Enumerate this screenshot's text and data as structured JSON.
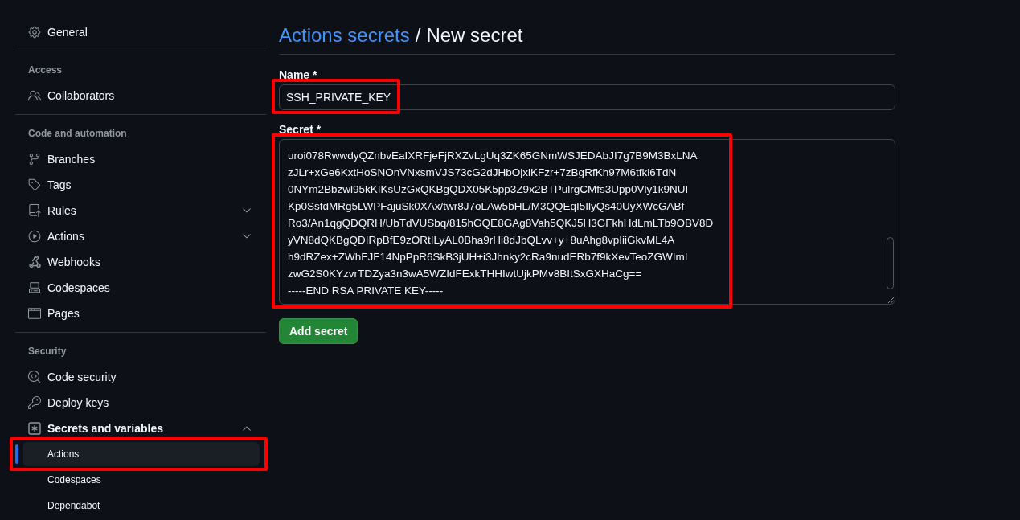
{
  "sidebar": {
    "sections": [
      {
        "items": [
          {
            "label": "General"
          }
        ]
      },
      {
        "heading": "Access",
        "items": [
          {
            "label": "Collaborators"
          }
        ]
      },
      {
        "heading": "Code and automation",
        "items": [
          {
            "label": "Branches"
          },
          {
            "label": "Tags"
          },
          {
            "label": "Rules",
            "expanded": false
          },
          {
            "label": "Actions",
            "expanded": false
          },
          {
            "label": "Webhooks"
          },
          {
            "label": "Codespaces"
          },
          {
            "label": "Pages"
          }
        ]
      },
      {
        "heading": "Security",
        "items": [
          {
            "label": "Code security"
          },
          {
            "label": "Deploy keys"
          },
          {
            "label": "Secrets and variables",
            "expanded": true,
            "children": [
              {
                "label": "Actions",
                "selected": true,
                "highlighted": true
              },
              {
                "label": "Codespaces",
                "selected": false,
                "highlighted": false
              },
              {
                "label": "Dependabot",
                "selected": false,
                "highlighted": false
              }
            ]
          }
        ]
      }
    ]
  },
  "header": {
    "breadcrumb_link": "Actions secrets",
    "separator": "/",
    "title": "New secret"
  },
  "form": {
    "name_field": {
      "label": "Name *",
      "value": "SSH_PRIVATE_KEY",
      "highlighted": true
    },
    "secret_field": {
      "label": "Secret *",
      "value": "uroi078RwwdyQZnbvEaIXRFjeFjRXZvLgUq3ZK65GNmWSJEDAbJI7g7B9M3BxLNA\nzJLr+xGe6KxtHoSNOnVNxsmVJS73cG2dJHbOjxlKFzr+7zBgRfKh97M6tfki6TdN\n0NYm2Bbzwl95kKIKsUzGxQKBgQDX05K5pp3Z9x2BTPulrgCMfs3Upp0Vly1k9NUI\nKp0SsfdMRg5LWPFajuSk0XAx/twr8J7oLAw5bHL/M3QQEqI5IlyQs40UyXWcGABf\nRo3/An1qgQDQRH/UbTdVUSbq/815hGQE8GAg8Vah5QKJ5H3GFkhHdLmLTb9OBV8D\nyVN8dQKBgQDIRpBfE9zORtILyAL0Bha9rHi8dJbQLvv+y+8uAhg8vpIiiGkvML4A\nh9dRZex+ZWhFJF14NpPpR6SkB3jUH+i3Jhnky2cRa9nudERb7f9kXevTeoZGWImI\nzwG2S0KYzvrTDZya3n3wA5WZIdFExkTHHIwtUjkPMv8BItSxGXHaCg==\n-----END RSA PRIVATE KEY-----",
      "highlighted": true
    },
    "submit_button": "Add secret"
  }
}
